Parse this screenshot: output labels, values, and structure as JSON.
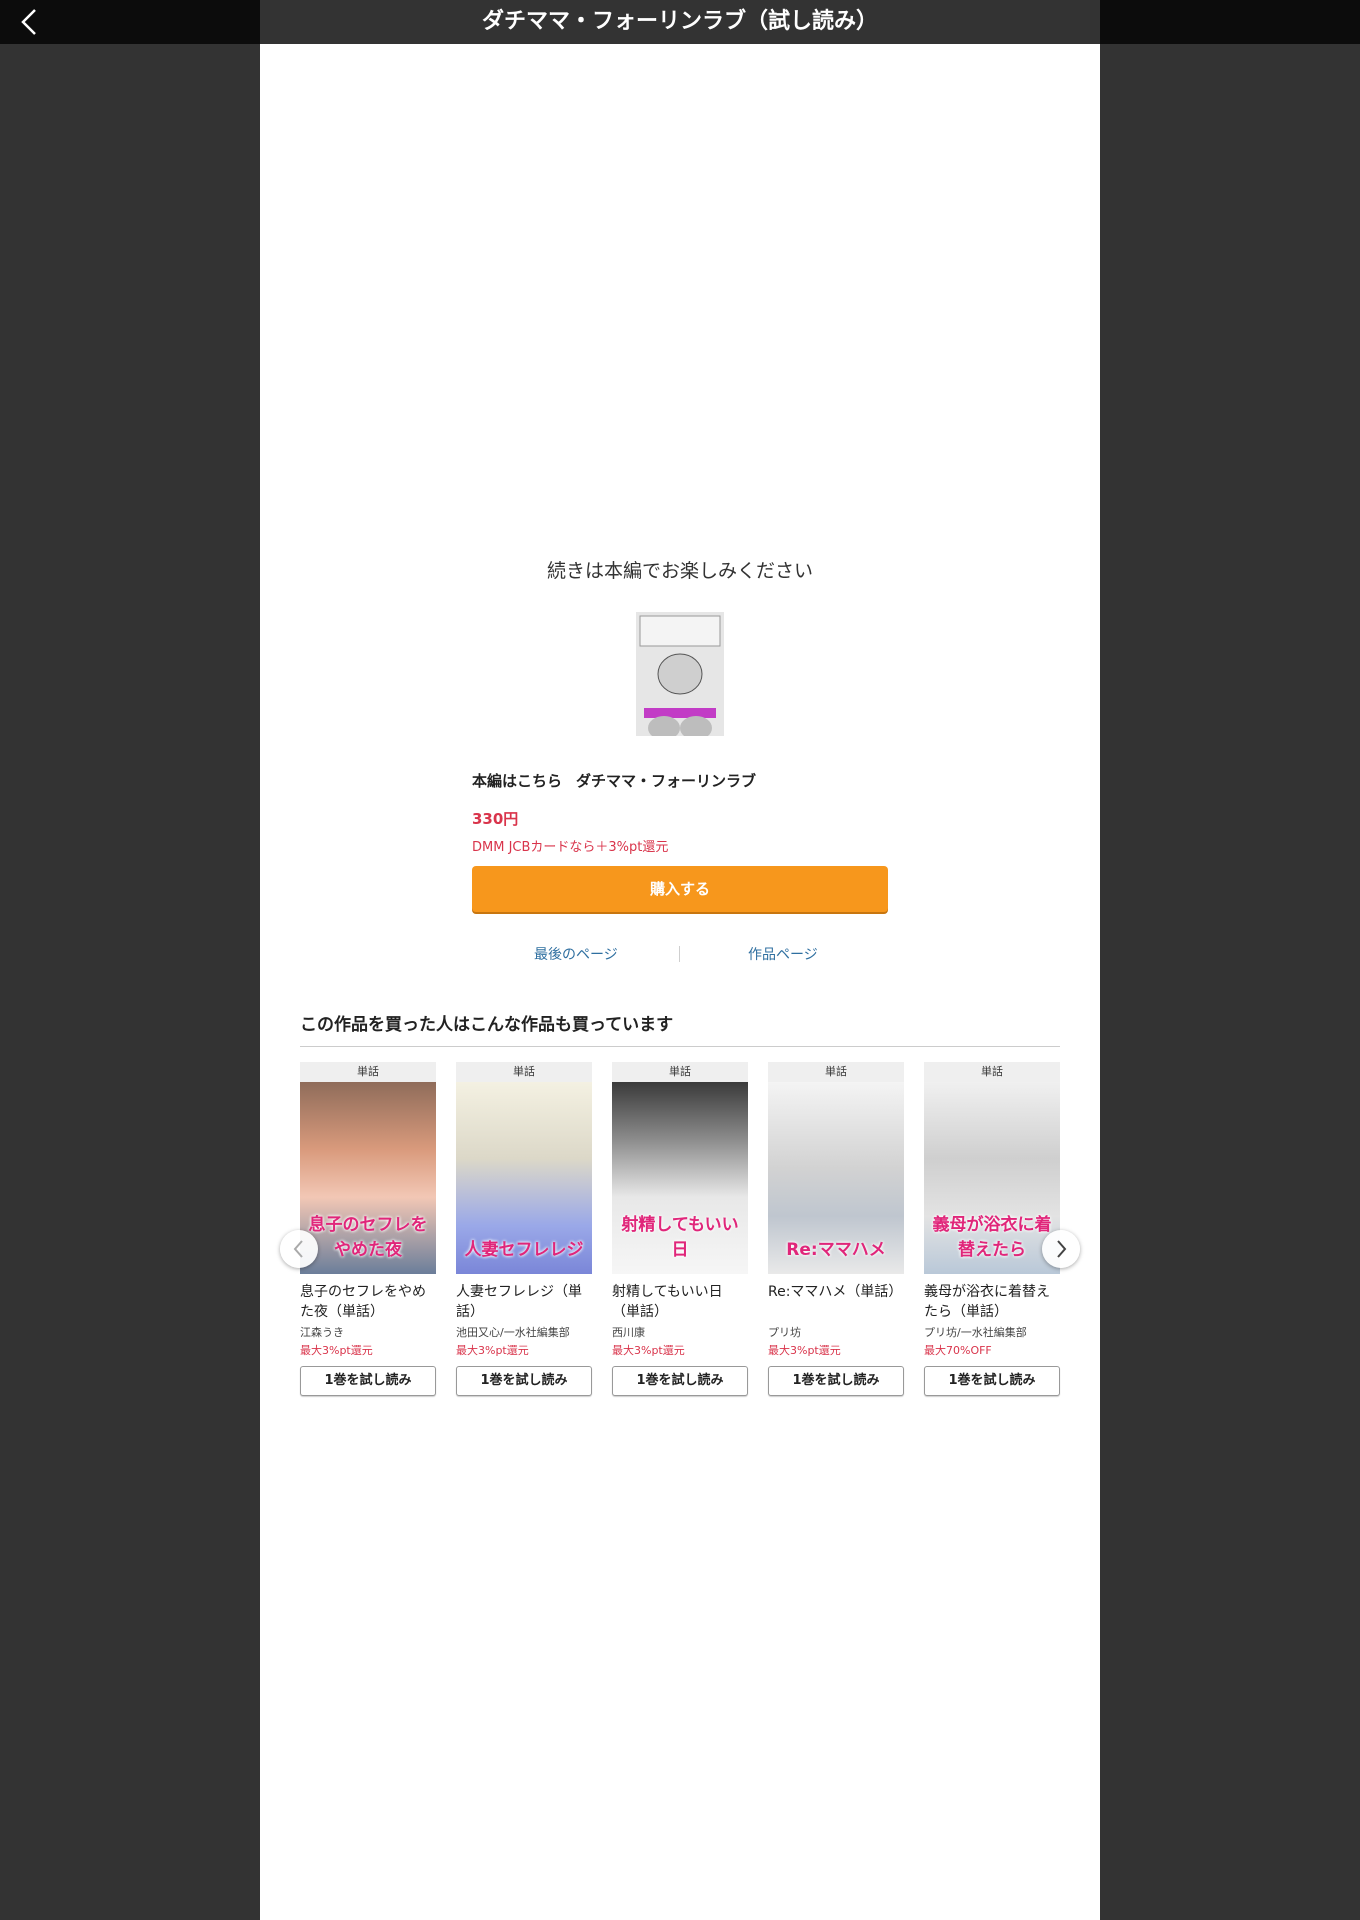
{
  "header": {
    "title": "ダチママ・フォーリンラブ（試し読み）"
  },
  "continue_message": "続きは本編でお楽しみください",
  "book": {
    "prefix": "本編はこちら",
    "title": "ダチママ・フォーリンラブ",
    "price": "330円",
    "jcb_note": "DMM JCBカードなら＋3%pt還元",
    "buy_label": "購入する"
  },
  "links": {
    "last_page": "最後のページ",
    "work_page": "作品ページ"
  },
  "recommend": {
    "heading": "この作品を買った人はこんな作品も買っています",
    "items": [
      {
        "badge": "単話",
        "cover_text": "息子のセフレをやめた夜",
        "title": "息子のセフレをやめた夜（単話）",
        "author": "江森うき",
        "point": "最大3%pt還元",
        "trial": "1巻を試し読み"
      },
      {
        "badge": "単話",
        "cover_text": "人妻セフレレジ",
        "title": "人妻セフレレジ（単話）",
        "author": "池田又心/一水社編集部",
        "point": "最大3%pt還元",
        "trial": "1巻を試し読み"
      },
      {
        "badge": "単話",
        "cover_text": "射精してもいい日",
        "title": "射精してもいい日（単話）",
        "author": "西川康",
        "point": "最大3%pt還元",
        "trial": "1巻を試し読み"
      },
      {
        "badge": "単話",
        "cover_text": "Re:ママハメ",
        "title": "Re:ママハメ（単話）",
        "author": "プリ坊",
        "point": "最大3%pt還元",
        "trial": "1巻を試し読み"
      },
      {
        "badge": "単話",
        "cover_text": "義母が浴衣に着替えたら",
        "title": "義母が浴衣に着替えたら（単話）",
        "author": "プリ坊/一水社編集部",
        "point": "最大70%OFF",
        "trial": "1巻を試し読み"
      }
    ]
  },
  "icons": {
    "back": "chevron-left-icon",
    "prev": "chevron-left-icon",
    "next": "chevron-right-icon"
  },
  "colors": {
    "accent": "#f7971c",
    "price": "#d9344b",
    "link": "#2f6fa0"
  }
}
